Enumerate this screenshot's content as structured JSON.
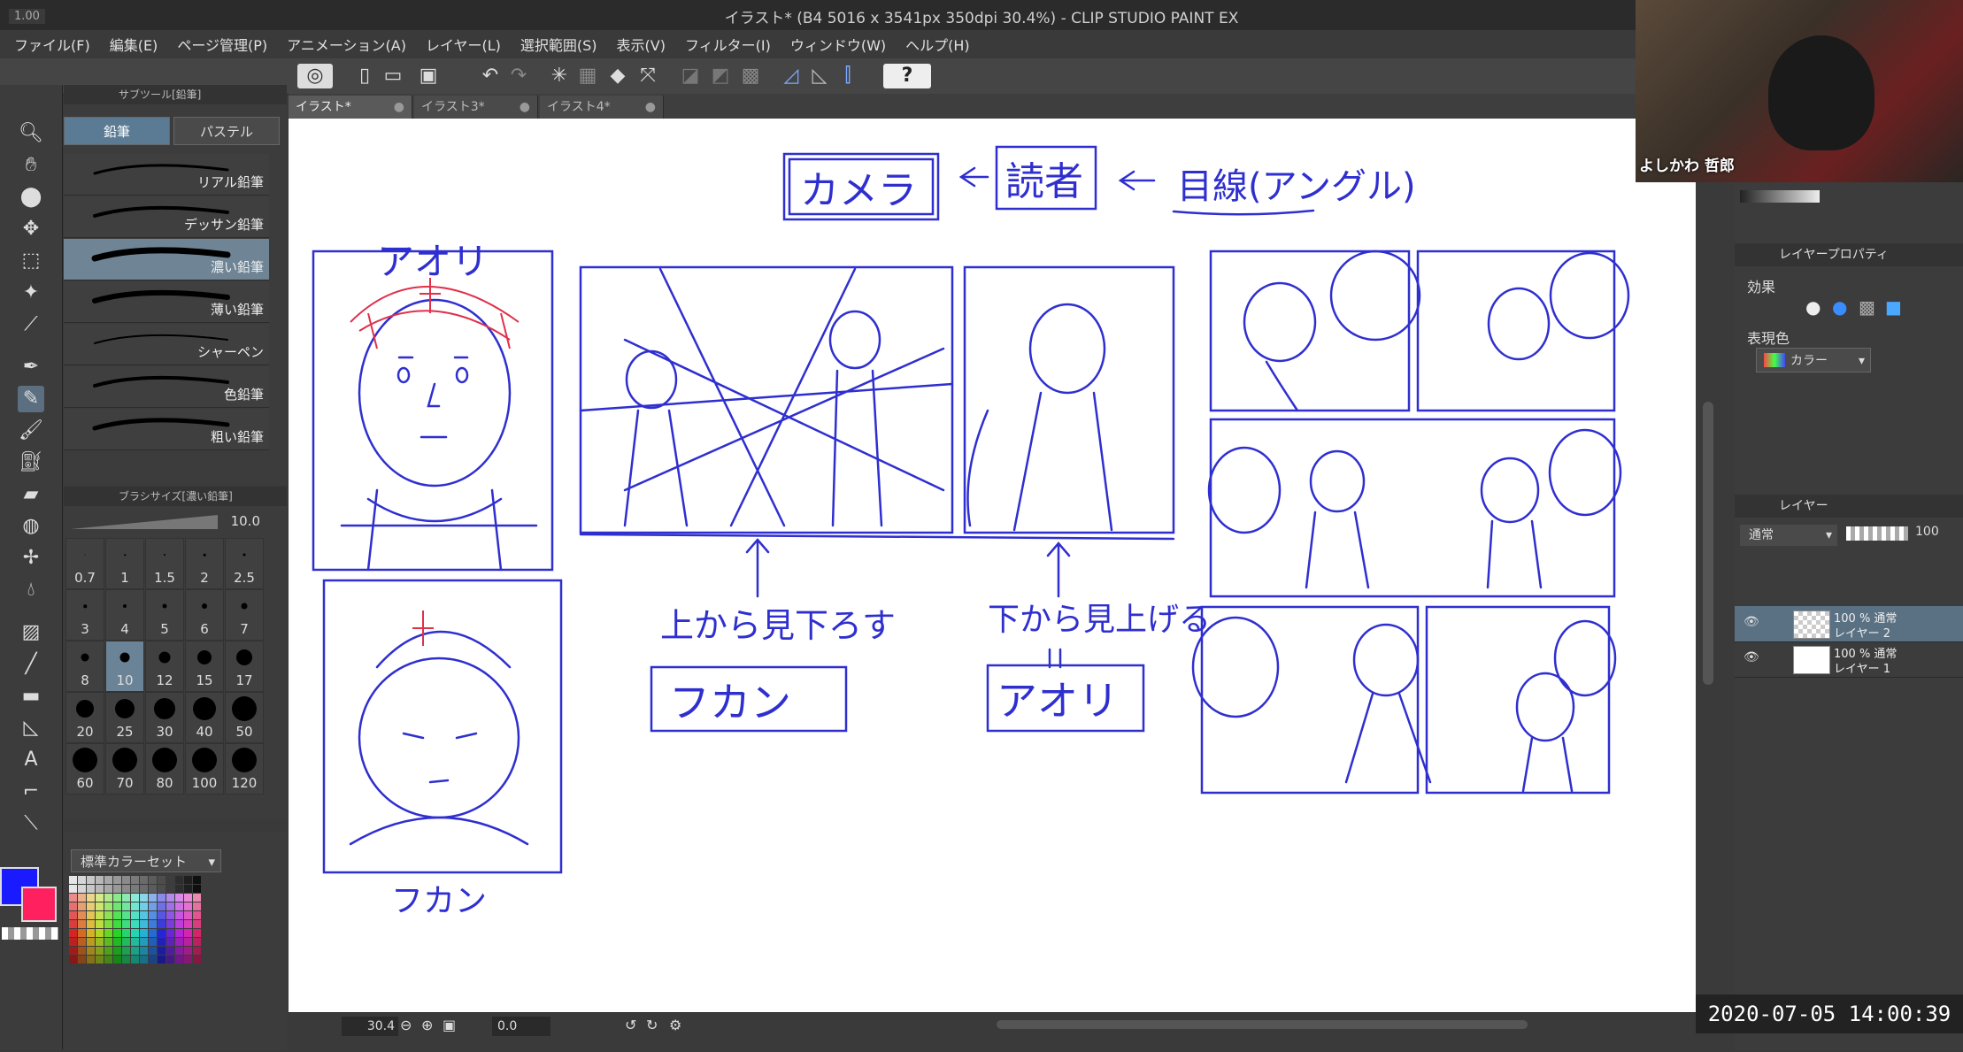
{
  "app": {
    "version_badge": "1.00",
    "window_title": "イラスト* (B4 5016 x 3541px 350dpi 30.4%)  - CLIP STUDIO PAINT EX"
  },
  "menu": [
    "ファイル(F)",
    "編集(E)",
    "ページ管理(P)",
    "アニメーション(A)",
    "レイヤー(L)",
    "選択範囲(S)",
    "表示(V)",
    "フィルター(I)",
    "ウィンドウ(W)",
    "ヘルプ(H)"
  ],
  "doc_tabs": [
    {
      "label": "イラスト*",
      "active": true
    },
    {
      "label": "イラスト3*",
      "active": false
    },
    {
      "label": "イラスト4*",
      "active": false
    }
  ],
  "subtool": {
    "panel_title": "サブツール[鉛筆]",
    "tabs": [
      "鉛筆",
      "パステル"
    ],
    "brushes": [
      "リアル鉛筆",
      "デッサン鉛筆",
      "濃い鉛筆",
      "薄い鉛筆",
      "シャーペン",
      "色鉛筆",
      "粗い鉛筆"
    ],
    "selected_brush": "濃い鉛筆"
  },
  "brush_size": {
    "panel_title": "ブラシサイズ[濃い鉛筆]",
    "current": "10.0",
    "sizes": [
      "0.7",
      "1",
      "1.5",
      "2",
      "2.5",
      "3",
      "4",
      "5",
      "6",
      "7",
      "8",
      "10",
      "12",
      "15",
      "17",
      "20",
      "25",
      "30",
      "40",
      "50",
      "60",
      "70",
      "80",
      "100",
      "120"
    ],
    "selected": "10"
  },
  "color_set": {
    "name": "標準カラーセット",
    "main_color": "#1a1aff",
    "sub_color": "#ff2060"
  },
  "canvas_text": {
    "camera": "カメラ",
    "reader": "読者",
    "gaze": "目線(アングル)",
    "aori_top": "アオリ",
    "fukan_bottom": "フカン",
    "look_down": "上から見下ろす",
    "look_up": "下から見上げる",
    "fukan_box": "フカン",
    "aori_box": "アオリ"
  },
  "bottom_bar": {
    "zoom": "30.4",
    "angle": "0.0"
  },
  "right_panel": {
    "layer_property_title": "レイヤープロパティ",
    "effect_label": "効果",
    "expression_color_label": "表現色",
    "expression_color_value": "カラー",
    "layer_title": "レイヤー",
    "blend_mode": "通常",
    "opacity": "100",
    "layers": [
      {
        "line1": "100 % 通常",
        "line2": "レイヤー 2",
        "selected": true,
        "transparent": true
      },
      {
        "line1": "100 % 通常",
        "line2": "レイヤー 1",
        "selected": false,
        "transparent": false
      }
    ]
  },
  "webcam": {
    "name": "よしかわ 哲郎"
  },
  "timestamp": "2020-07-05  14:00:39",
  "colors": {
    "ink": "#2f2fd0",
    "accent_red": "#e0304a"
  }
}
